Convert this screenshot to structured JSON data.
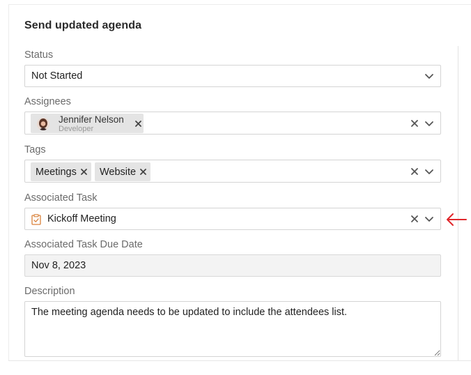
{
  "title": "Send updated agenda",
  "status": {
    "label": "Status",
    "value": "Not Started"
  },
  "assignees": {
    "label": "Assignees",
    "items": [
      {
        "name": "Jennifer Nelson",
        "role": "Developer"
      }
    ]
  },
  "tags": {
    "label": "Tags",
    "items": [
      {
        "label": "Meetings"
      },
      {
        "label": "Website"
      }
    ]
  },
  "associated_task": {
    "label": "Associated Task",
    "value": "Kickoff Meeting"
  },
  "due_date": {
    "label": "Associated Task Due Date",
    "value": "Nov 8, 2023"
  },
  "description": {
    "label": "Description",
    "value": "The meeting agenda needs to be updated to include the attendees list."
  },
  "colors": {
    "annotation_arrow": "#e0262b",
    "task_icon": "#d9813a"
  },
  "icons": [
    "chevron-down-icon",
    "clear-icon",
    "remove-chip-icon",
    "task-icon",
    "avatar",
    "annotation-arrow-icon"
  ]
}
